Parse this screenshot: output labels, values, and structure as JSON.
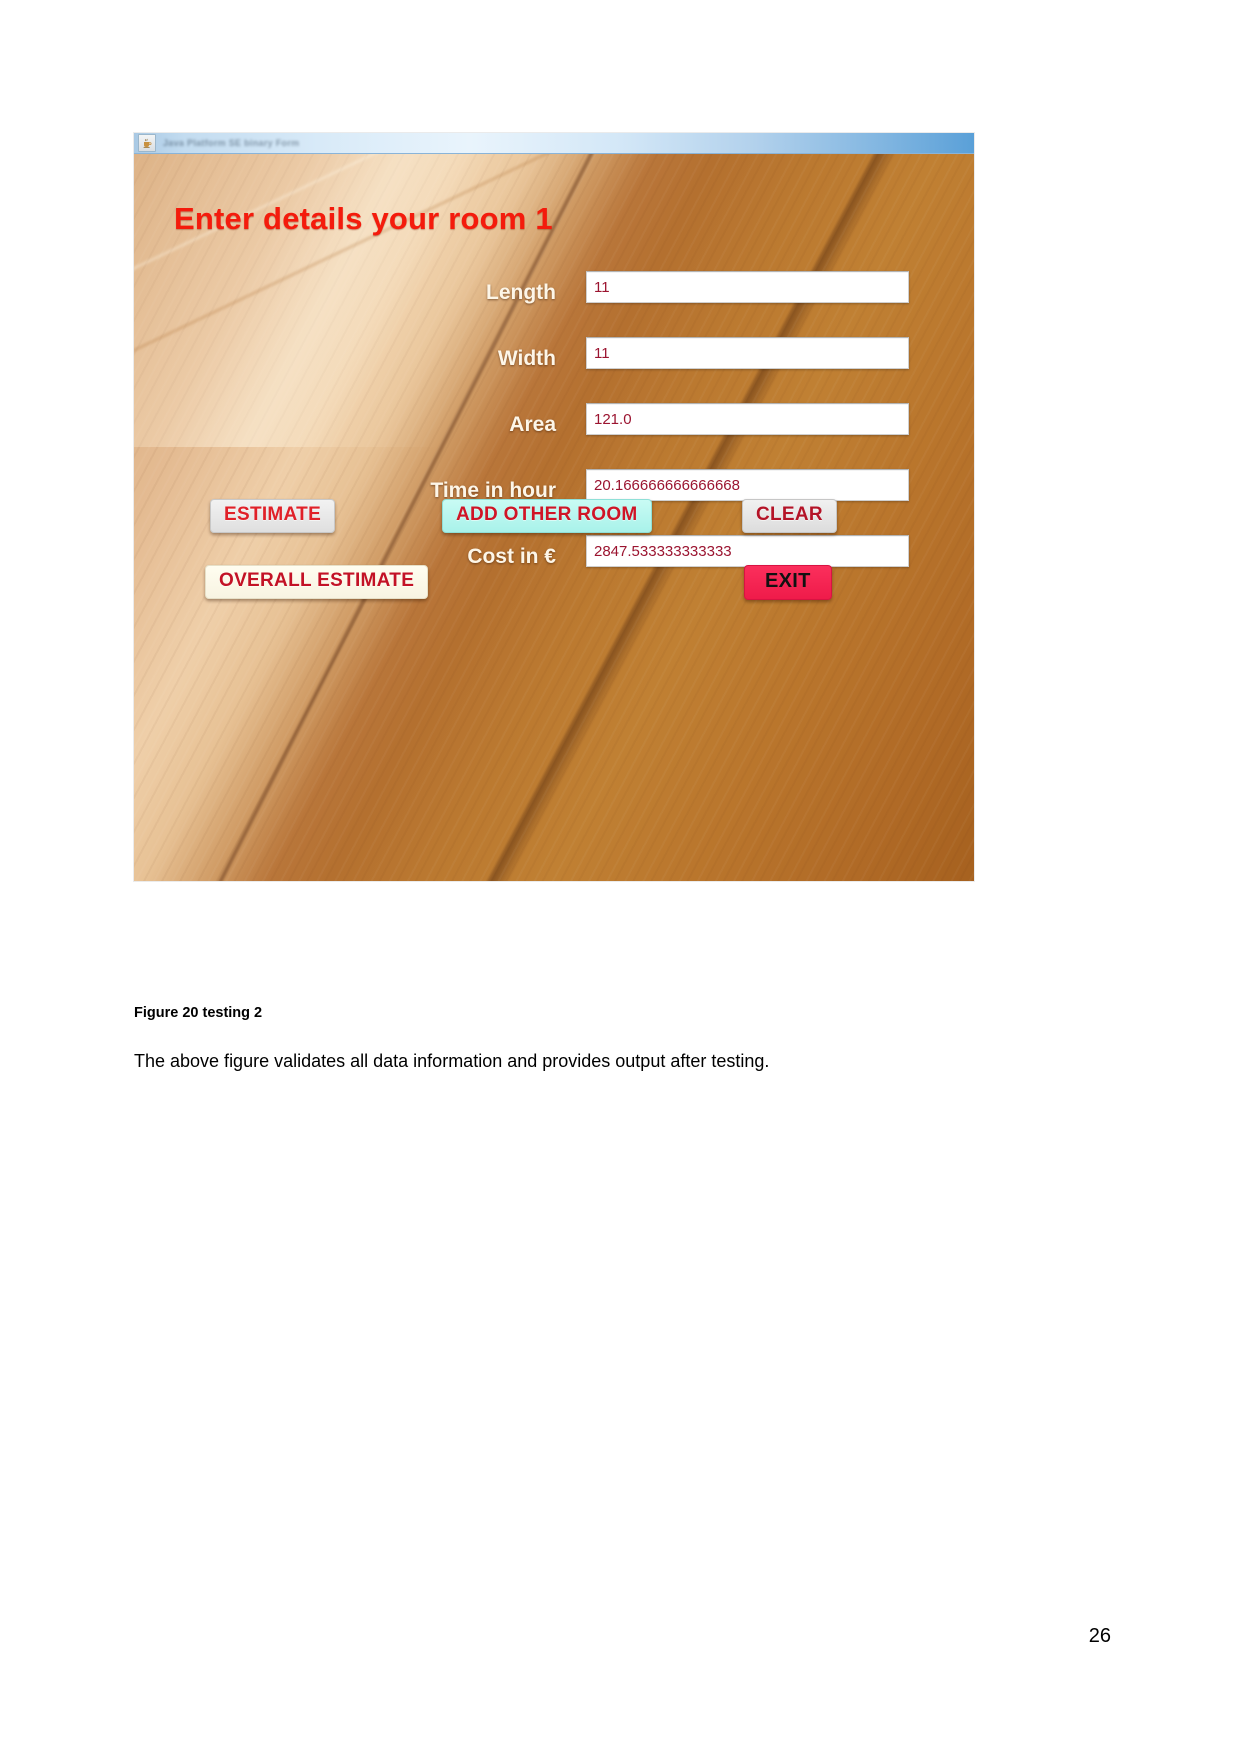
{
  "document": {
    "figure_caption": "Figure 20 testing 2",
    "body_paragraph": "The above figure validates all data information and provides output after testing.",
    "page_number": "26"
  },
  "app_window": {
    "titlebar": {
      "icon": "java-coffee-cup-icon",
      "title": "Java Platform SE binary Form"
    },
    "heading": "Enter details your room 1",
    "fields": [
      {
        "label": "Length",
        "value": "11"
      },
      {
        "label": "Width",
        "value": "11"
      },
      {
        "label": "Area",
        "value": "121.0"
      },
      {
        "label": "Time in hour",
        "value": "20.166666666666668"
      },
      {
        "label": "Cost in €",
        "value": "2847.533333333333"
      }
    ],
    "buttons": {
      "estimate": "ESTIMATE",
      "add_other_room": "ADD OTHER ROOM",
      "clear": "CLEAR",
      "overall_estimate": "OVERALL ESTIMATE",
      "exit": "EXIT"
    },
    "colors": {
      "heading_red": "#f41b0c",
      "field_value_maroon": "#9b1430",
      "label_cream": "#fdf6e8",
      "add_room_cyan": "#a9f2ea",
      "exit_pink": "#ef1b4a",
      "overall_ivory": "#fffdf0",
      "wood_brown": "#b9752c"
    }
  }
}
